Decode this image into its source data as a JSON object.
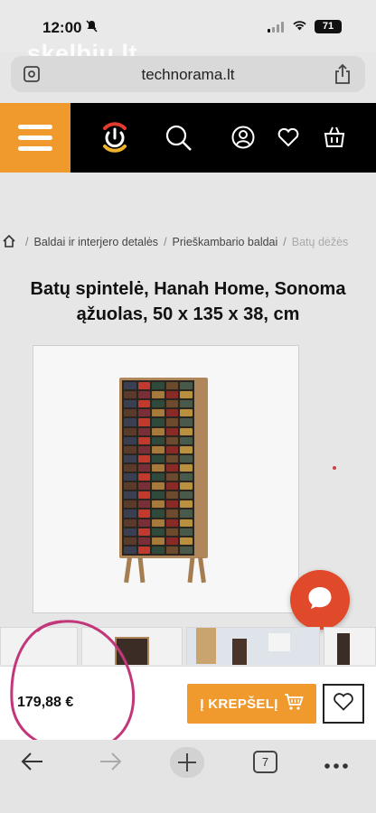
{
  "status_bar": {
    "time": "12:00",
    "battery": "71",
    "watermark": "skelbiu.lt"
  },
  "browser": {
    "url": "technorama.lt",
    "tab_count": "7"
  },
  "icons": {
    "menu": "hamburger-menu-icon",
    "logo": "power-logo-icon",
    "search": "search-icon",
    "account": "user-icon",
    "wishlist": "heart-icon",
    "bag": "shopping-bag-icon",
    "cart": "cart-icon",
    "chat": "chat-icon",
    "home": "home-icon"
  },
  "breadcrumb": {
    "items": [
      "Baldai ir interjero detalės",
      "Prieškambario baldai",
      "Batų dėžės"
    ]
  },
  "product": {
    "title": "Batų spintelė, Hanah Home, Sonoma ąžuolas, 50 x 135 x 38, cm",
    "price": "179,88 €",
    "add_to_cart": "Į KREPŠELĮ"
  },
  "colors": {
    "brand_orange": "#f0992c",
    "header_bg": "#000000",
    "chat_red": "#e04a2a",
    "annotation": "#c2367a"
  }
}
